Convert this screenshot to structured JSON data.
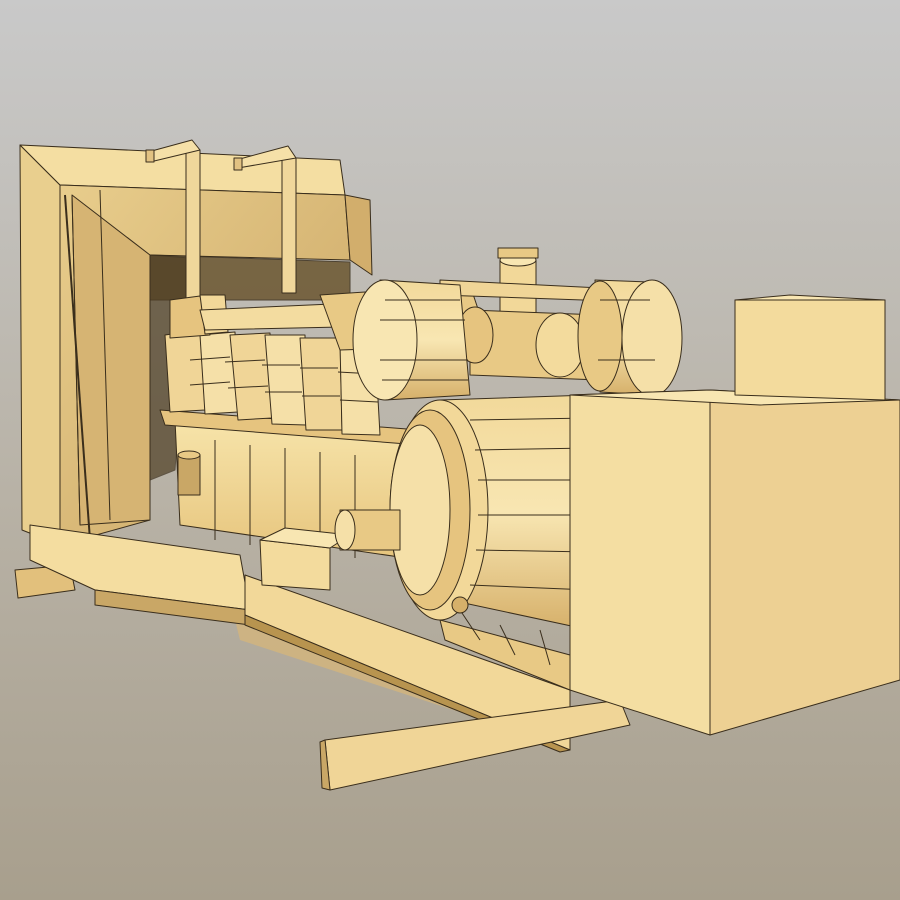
{
  "scene": {
    "subject": "generator-set-3d-model",
    "colors": {
      "background_top": "#c9c9c9",
      "background_bottom": "#a89f8d",
      "body_light": "#f6e2a6",
      "body_mid": "#e8c985",
      "body_shade": "#c9a766",
      "body_dark": "#8a6f3e",
      "edge": "#3a2e1c",
      "shadow": "#d9b677"
    }
  }
}
